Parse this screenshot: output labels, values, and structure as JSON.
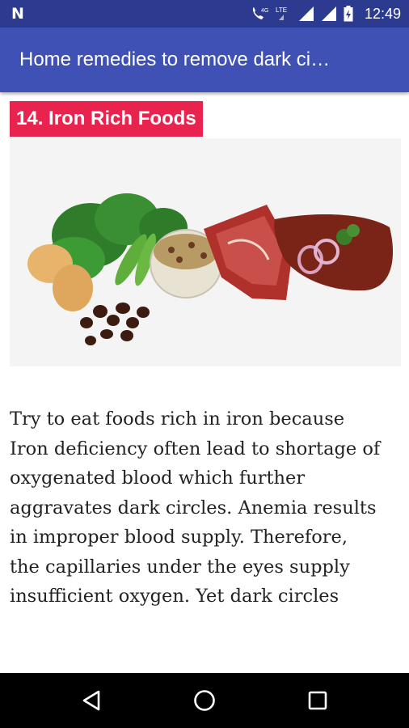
{
  "status_bar": {
    "time": "12:49",
    "network_label": "4G",
    "icons": [
      "notification-n-icon",
      "wifi-calling-icon",
      "lte-icon",
      "signal-icon",
      "signal-icon",
      "battery-icon"
    ]
  },
  "app_bar": {
    "title": "Home remedies to remove dark ci…"
  },
  "article": {
    "heading": "14. Iron Rich Foods",
    "image_alt": "Iron rich foods: spinach, eggs, peas, raisins, beans, red meat and liver",
    "body_lines": [
      "Try to eat foods rich in iron because",
      "Iron deficiency often lead to shortage of",
      "oxygenated blood which further",
      "aggravates dark circles. Anemia results",
      "in improper blood supply. Therefore,",
      "the capillaries under the eyes supply",
      "insufficient oxygen. Yet dark circles"
    ]
  },
  "nav_bar": {
    "buttons": [
      "back-icon",
      "home-icon",
      "recents-icon"
    ]
  },
  "colors": {
    "status_bar": "#2c3b8f",
    "app_bar": "#3f51b5",
    "heading_badge": "#e8244e",
    "nav_bar": "#000000"
  }
}
